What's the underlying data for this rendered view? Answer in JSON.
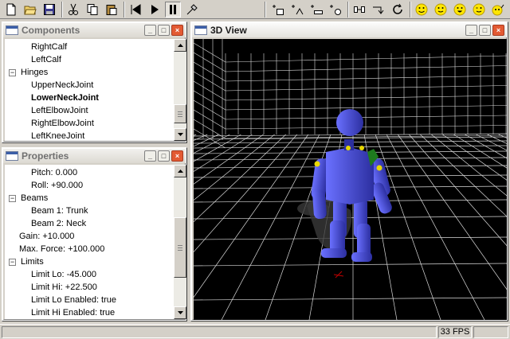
{
  "toolbar": {
    "buttons": [
      "new-file-icon",
      "open-folder-icon",
      "save-icon",
      "cut-icon",
      "copy-icon",
      "paste-icon",
      "rewind-icon",
      "play-icon",
      "pause-icon",
      "tool-icon",
      "add-body-icon",
      "add-hinge-icon",
      "add-beam-icon",
      "add-sensor-icon",
      "connect-icon",
      "arrow-icon",
      "rotate-icon",
      "happy-face-icon",
      "smile-face-icon",
      "grin-face-icon",
      "wink-face-icon",
      "point-face-icon"
    ]
  },
  "components": {
    "title": "Components",
    "items": [
      {
        "label": "RightCalf",
        "level": 1,
        "bold": false
      },
      {
        "label": "LeftCalf",
        "level": 1,
        "bold": false
      },
      {
        "label": "Hinges",
        "level": 0,
        "bold": false,
        "expander": "−"
      },
      {
        "label": "UpperNeckJoint",
        "level": 1,
        "bold": false
      },
      {
        "label": "LowerNeckJoint",
        "level": 1,
        "bold": true
      },
      {
        "label": "LeftElbowJoint",
        "level": 1,
        "bold": false
      },
      {
        "label": "RightElbowJoint",
        "level": 1,
        "bold": false
      },
      {
        "label": "LeftKneeJoint",
        "level": 1,
        "bold": false
      }
    ]
  },
  "properties": {
    "title": "Properties",
    "items": [
      {
        "label": "Pitch:  0.000",
        "level": 1
      },
      {
        "label": "Roll: +90.000",
        "level": 1
      },
      {
        "label": "Beams",
        "level": 0,
        "expander": "−"
      },
      {
        "label": "Beam 1: Trunk",
        "level": 1
      },
      {
        "label": "Beam 2: Neck",
        "level": 1
      },
      {
        "label": "Gain: +10.000",
        "level": 0.5
      },
      {
        "label": "Max. Force: +100.000",
        "level": 0.5
      },
      {
        "label": "Limits",
        "level": 0,
        "expander": "−"
      },
      {
        "label": "Limit Lo: -45.000",
        "level": 1
      },
      {
        "label": "Limit Hi: +22.500",
        "level": 1
      },
      {
        "label": "Limit Lo Enabled: true",
        "level": 1
      },
      {
        "label": "Limit Hi Enabled: true",
        "level": 1
      }
    ]
  },
  "view3d": {
    "title": "3D View"
  },
  "status": {
    "fps": "33 FPS"
  },
  "colors": {
    "robot": "#4a4fe0",
    "robot_dark": "#2c2fa0",
    "joint": "#e8d800",
    "accent_green": "#1e7a1e",
    "grid": "#dcdcdc",
    "close_button": "#e35a33"
  }
}
